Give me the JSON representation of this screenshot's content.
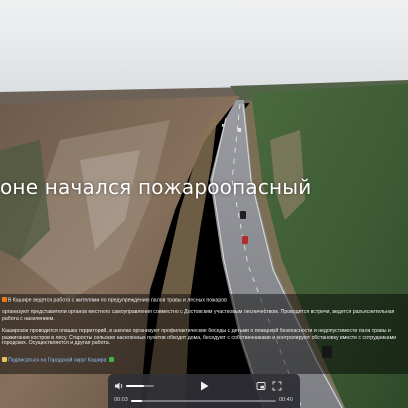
{
  "video": {
    "subtitle": "оне начался пожароопасный",
    "current_time": "00:03",
    "duration": "00:40",
    "progress_fraction": 0.075,
    "volume_fraction": 0.65
  },
  "post": {
    "lines": [
      "В Кашире ведется работа с жителями по предупреждению палов травы и лесных пожаров",
      "организуют представители органов местного самоуправления совместно с Достовским участковым лесничеством. Проводятся встречи, ведется разъяснительная",
      "работа с населением.",
      "Каширское проводится опашка территорий, в школах организуют профилактические беседы с детьми о пожарной безопасности и недопустимости пала травы и",
      "разжигания костров в лесу. Старосты сельских населенных пунктов обходят дома, беседуют с собственниками и контролируют обстановку вместе с сотрудниками",
      "городских. Осуществляется и другая работа.",
      "",
      "Подписаться на Городской округ Кашира"
    ]
  },
  "icons": {
    "fire": "fire-icon",
    "check": "check-icon",
    "volume": "volume-icon",
    "play": "play-icon",
    "pip": "picture-in-picture-icon",
    "fullscreen": "fullscreen-icon"
  },
  "colors": {
    "sky": "#e6e8ea",
    "forest_dark": "#3a5a35",
    "forest_bare": "#7a5e4a",
    "road": "#8f9094",
    "link": "#8fc2ff",
    "player_bg": "#2e2e34",
    "check_green": "#3fb24a",
    "fire_orange": "#f07a1a"
  }
}
